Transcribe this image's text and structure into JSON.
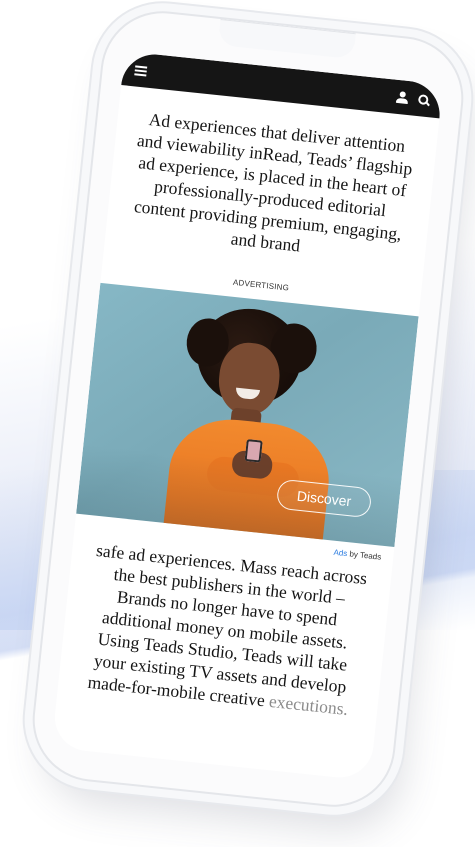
{
  "header": {
    "menu_icon": "hamburger-menu-icon",
    "user_icon": "user-icon",
    "search_icon": "search-icon"
  },
  "article": {
    "paragraph_1": "Ad experiences that deliver attention and viewability inRead, Teads’ flagship ad experience, is placed in the heart of professionally-produced editorial content providing premium, engaging, and brand",
    "advertising_label": "ADVERTISING",
    "ad": {
      "cta_label": "Discover",
      "credit_ads": "Ads",
      "credit_by": " by Teads"
    },
    "paragraph_2": "safe ad experiences. Mass reach across the best publishers in the world – Brands no longer have to spend additional money on mobile assets. Using Teads Studio, Teads will take your existing TV assets and develop made-for-mobile creative",
    "paragraph_2_end": "executions."
  },
  "colors": {
    "topbar": "#151515",
    "ad_background": "#86b7c5",
    "sweater": "#e97722",
    "link_blue": "#2d7de0"
  }
}
